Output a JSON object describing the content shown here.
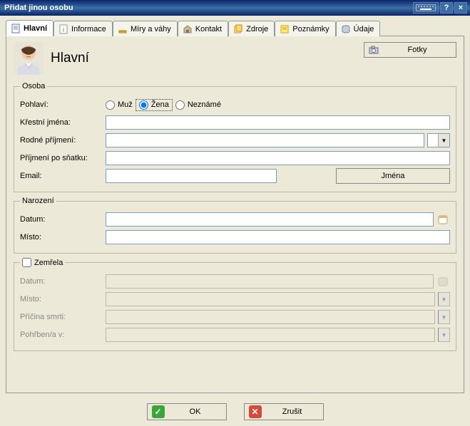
{
  "window": {
    "title": "Přidat jinou osobu",
    "help": "?",
    "close": "×"
  },
  "tabs": [
    {
      "label": "Hlavní"
    },
    {
      "label": "Informace"
    },
    {
      "label": "Míry a váhy"
    },
    {
      "label": "Kontakt"
    },
    {
      "label": "Zdroje"
    },
    {
      "label": "Poznámky"
    },
    {
      "label": "Údaje"
    }
  ],
  "header": {
    "title": "Hlavní",
    "photos_btn": "Fotky"
  },
  "osoba": {
    "legend": "Osoba",
    "gender_label": "Pohlaví:",
    "gender_male": "Muž",
    "gender_female": "Žena",
    "gender_unknown": "Neznámé",
    "given_names_label": "Křestní jména:",
    "given_names": "",
    "maiden_label": "Rodné příjmení:",
    "maiden": "",
    "married_label": "Příjmení po sňatku:",
    "married": "",
    "email_label": "Email:",
    "email": "",
    "names_btn": "Jména"
  },
  "narozeni": {
    "legend": "Narození",
    "date_label": "Datum:",
    "date": "",
    "place_label": "Místo:",
    "place": ""
  },
  "zemrela": {
    "legend": "Zemřela",
    "date_label": "Datum:",
    "date": "",
    "place_label": "Místo:",
    "place": "",
    "cause_label": "Příčina smrti:",
    "cause": "",
    "burial_label": "Pohřben/a v:",
    "burial": ""
  },
  "actions": {
    "ok": "OK",
    "cancel": "Zrušit"
  }
}
